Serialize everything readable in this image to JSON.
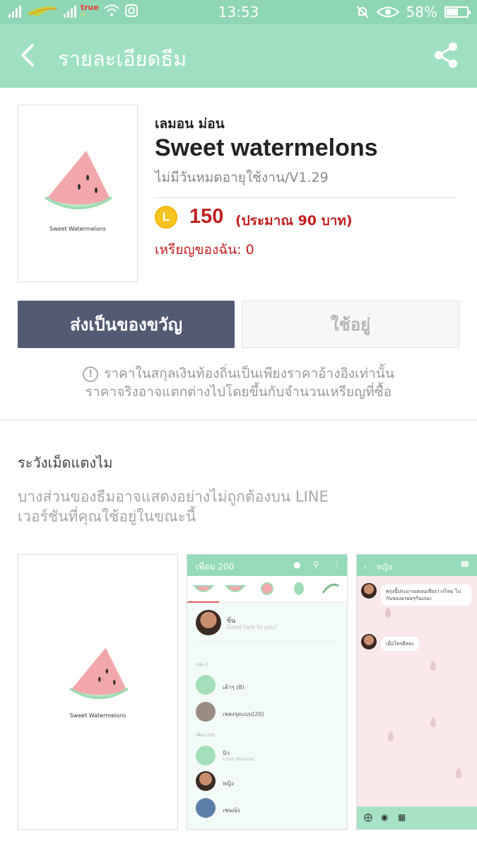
{
  "status_bar": {
    "carrier": "true",
    "carrier_sub": "H",
    "time": "13:53",
    "battery": "58%",
    "battery_level": 0.58
  },
  "header": {
    "title": "รายละเอียดธีม",
    "back_icon": "back-arrow-icon",
    "share_icon": "share-icon"
  },
  "theme": {
    "author": "เลมอน ม่อน",
    "name": "Sweet watermelons",
    "validity": "ไม่มีวันหมดอายุใช้งาน/V1.29",
    "thumbnail_caption": "Sweet Watermelons",
    "coin_letter": "L",
    "price": "150",
    "price_approx": "(ประมาณ 90 บาท)",
    "my_coins": "เหรียญของฉัน: 0"
  },
  "buttons": {
    "gift": "ส่งเป็นของขวัญ",
    "in_use": "ใช้อยู่"
  },
  "note": {
    "line1": "ราคาในสกุลเงินท้องถิ่นเป็นเพียงราคาอ้างอิงเท่านั้น",
    "line2": "ราคาจริงอาจแตกต่างไปโดยขึ้นกับจำนวนเหรียญที่ซื้อ",
    "icon": "!"
  },
  "warning": {
    "title": "ระวังเม็ดแตงไม",
    "line1": "บางส่วนของธีมอาจแสดงอย่างไม่ถูกต้องบน LINE",
    "line2": "เวอร์ชันที่คุณใช้อยู่ในขณะนี้"
  },
  "previews": {
    "cover_caption": "Sweet Watermelons",
    "friends": {
      "header": "เพื่อน 200",
      "profile_name": "ขิ่น",
      "profile_status": "Good luck to you!",
      "groups_label": "กลุ่ม 2",
      "friends_label": "เพื่อน 200",
      "rows": [
        "เต้าๆ (8)",
        "เพลงจุดแบบ(20)",
        "นิว",
        "หญิง",
        "เชษณ์ร"
      ],
      "row_sub": "Love Mousse"
    },
    "chat": {
      "header": "หญิง",
      "msg1": "พรุ่งนี้ประมาณตอนเที่ยงว่างไหม ไปกินของอร่อยๆกันเถอะ",
      "msg2": "เมื่อไหร่ดีหละ"
    }
  },
  "colors": {
    "header_bg": "#9fe0c3",
    "status_bg": "#8fd6b5",
    "gift_button": "#525a74",
    "price_red": "#c21f1f",
    "coin_gold": "#f6c521"
  }
}
